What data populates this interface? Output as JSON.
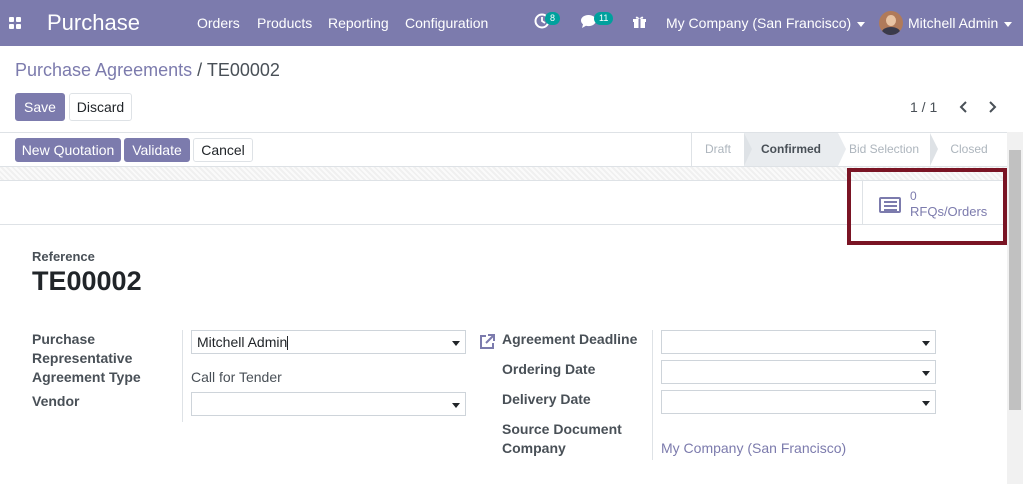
{
  "navbar": {
    "brand": "Purchase",
    "menu": [
      "Orders",
      "Products",
      "Reporting",
      "Configuration"
    ],
    "activity_count": "8",
    "message_count": "11",
    "company": "My Company (San Francisco)",
    "user": "Mitchell Admin"
  },
  "breadcrumb": {
    "parent": "Purchase Agreements",
    "separator": "/",
    "current": "TE00002"
  },
  "control": {
    "save_label": "Save",
    "discard_label": "Discard",
    "pager": "1 / 1"
  },
  "header_buttons": {
    "new_quotation": "New Quotation",
    "validate": "Validate",
    "cancel": "Cancel"
  },
  "statusbar": {
    "stages": [
      "Draft",
      "Confirmed",
      "Bid Selection",
      "Closed"
    ],
    "active_stage": "Confirmed"
  },
  "smart_button": {
    "value": "0",
    "label": "RFQs/Orders"
  },
  "form": {
    "reference_label": "Reference",
    "reference_value": "TE00002",
    "purchase_rep_label_1": "Purchase",
    "purchase_rep_label_2": "Representative",
    "purchase_rep_value": "Mitchell Admin",
    "agreement_type_label": "Agreement Type",
    "agreement_type_value": "Call for Tender",
    "vendor_label": "Vendor",
    "vendor_value": "",
    "agreement_deadline_label": "Agreement Deadline",
    "ordering_date_label": "Ordering Date",
    "delivery_date_label": "Delivery Date",
    "source_document_label": "Source Document",
    "company_label": "Company",
    "company_value": "My Company (San Francisco)"
  },
  "colors": {
    "brand": "#7c7bad",
    "badge": "#00a09d",
    "highlight": "#7a1424"
  }
}
